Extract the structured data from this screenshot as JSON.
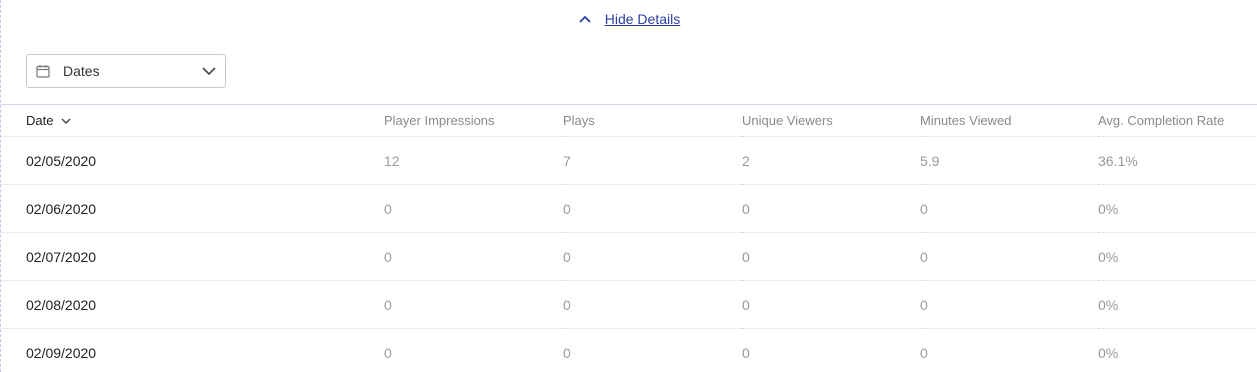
{
  "details_toggle": {
    "label": "Hide Details",
    "icon": "chevron-up-icon"
  },
  "date_filter": {
    "label": "Dates",
    "icon": "calendar-icon",
    "dropdown_icon": "chevron-down-icon"
  },
  "table": {
    "columns": [
      "Date",
      "Player Impressions",
      "Plays",
      "Unique Viewers",
      "Minutes Viewed",
      "Avg. Completion Rate"
    ],
    "sorted_column": "Date",
    "sort_direction": "descending",
    "rows": [
      [
        "02/05/2020",
        "12",
        "7",
        "2",
        "5.9",
        "36.1%"
      ],
      [
        "02/06/2020",
        "0",
        "0",
        "0",
        "0",
        "0%"
      ],
      [
        "02/07/2020",
        "0",
        "0",
        "0",
        "0",
        "0%"
      ],
      [
        "02/08/2020",
        "0",
        "0",
        "0",
        "0",
        "0%"
      ],
      [
        "02/09/2020",
        "0",
        "0",
        "0",
        "0",
        "0%"
      ]
    ]
  }
}
